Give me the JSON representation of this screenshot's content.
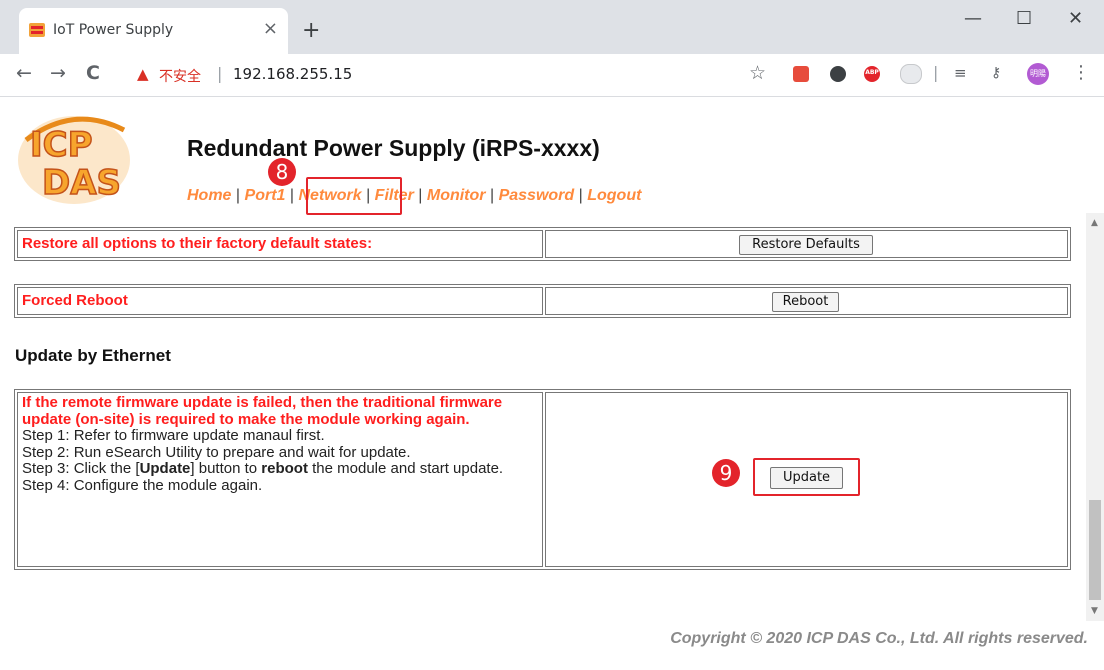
{
  "browser": {
    "tab_title": "IoT Power Supply",
    "tab_close": "×",
    "new_tab": "+",
    "window_minimize": "—",
    "window_maximize": "☐",
    "window_close": "✕",
    "back": "←",
    "forward": "→",
    "reload": "C",
    "insecure_label": "不安全",
    "separator": "|",
    "url": "192.168.255.15",
    "bookmark": "☆",
    "ext_abp": "ABP",
    "profile_label": "明陽",
    "menu": "⋮"
  },
  "header": {
    "title": "Redundant Power Supply (iRPS-xxxx)",
    "nav": [
      "Home",
      "Port1",
      "Network",
      "Filter",
      "Monitor",
      "Password",
      "Logout"
    ],
    "nav_sep": "|",
    "badge_network": "8"
  },
  "restore": {
    "label": "Restore all options to their factory default states:",
    "button": "Restore Defaults"
  },
  "reboot": {
    "label": "Forced Reboot",
    "button": "Reboot"
  },
  "update": {
    "section_title": "Update by Ethernet",
    "warning": "If the remote firmware update is failed, then the traditional firmware update (on-site) is required to make the module working again.",
    "step1": "Step 1: Refer to firmware update manaul first.",
    "step2": "Step 2: Run eSearch Utility to prepare and wait for update.",
    "step3_pre": "Step 3: Click the [",
    "step3_btn": "Update",
    "step3_mid": "] button to ",
    "step3_bold": "reboot",
    "step3_post": " the module and start update.",
    "step4": "Step 4: Configure the module again.",
    "button": "Update",
    "badge": "9"
  },
  "footer": {
    "copyright": "Copyright © 2020 ICP DAS Co., Ltd. All rights reserved."
  },
  "colors": {
    "accent_red": "#e3242b",
    "nav_orange": "#ff8a3d",
    "label_red": "#ff1e1e"
  }
}
